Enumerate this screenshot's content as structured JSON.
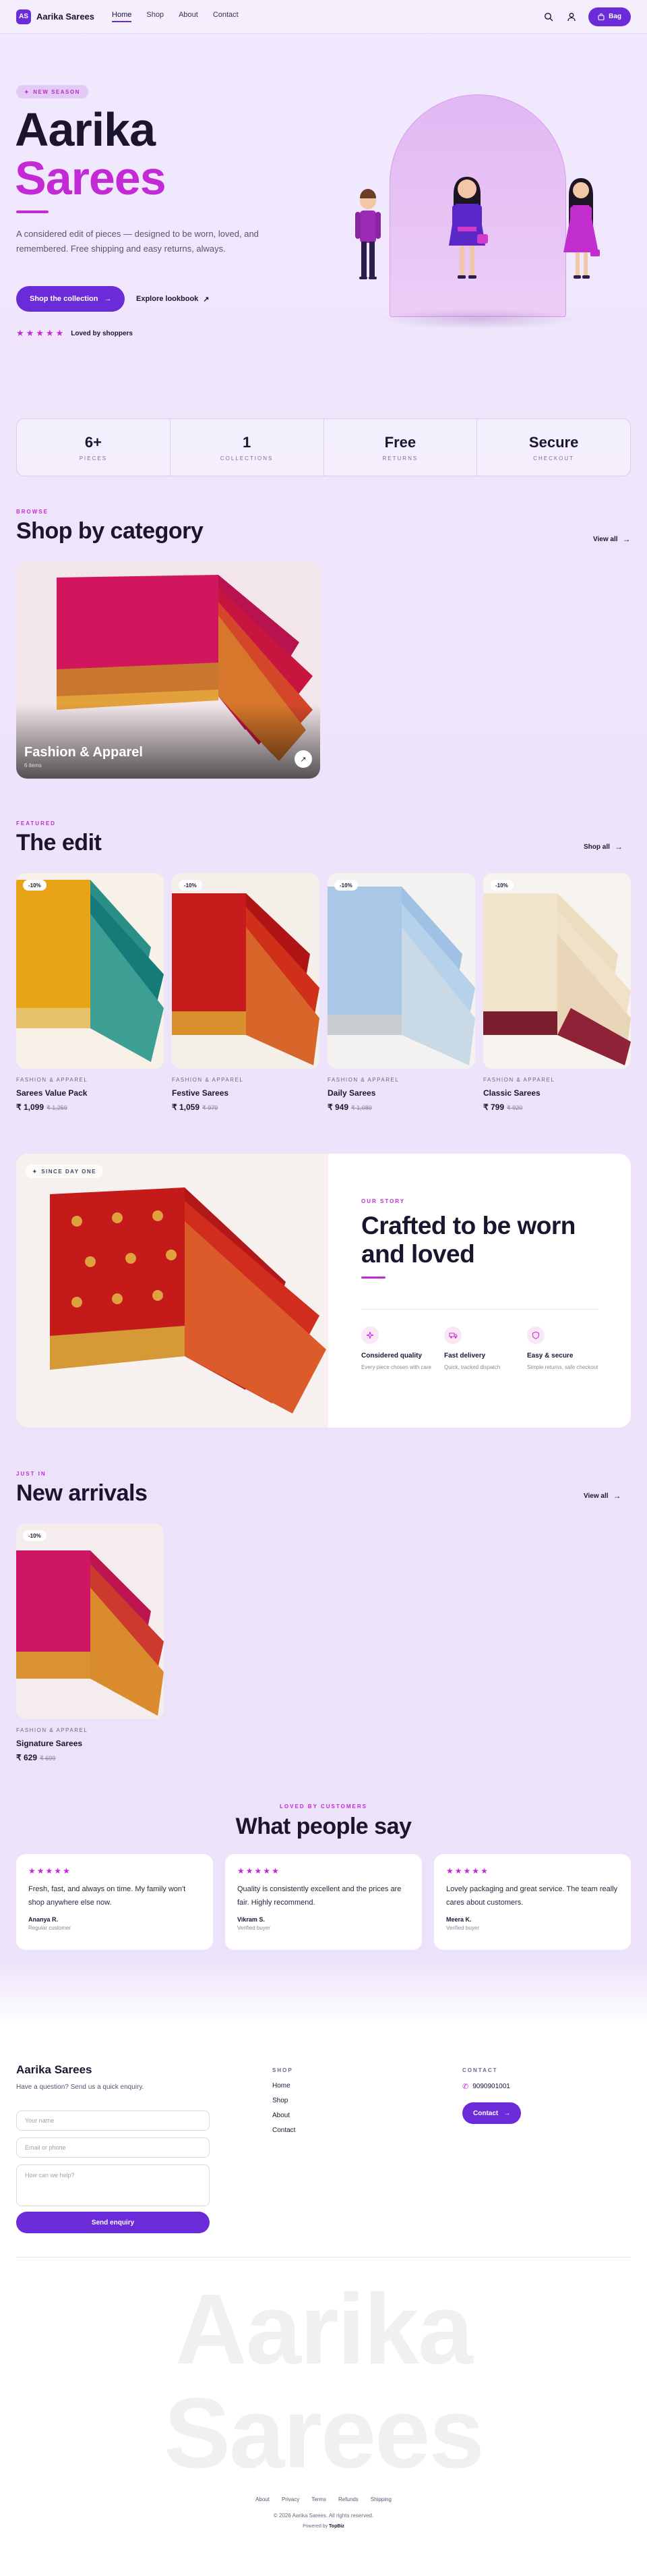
{
  "header": {
    "logo_mark": "AS",
    "brand": "Aarika Sarees",
    "nav": [
      "Home",
      "Shop",
      "About",
      "Contact"
    ],
    "bag_label": "Bag",
    "icons": [
      "search-icon",
      "user-icon",
      "bag-icon"
    ]
  },
  "hero": {
    "pill": "NEW SEASON",
    "title_line1": "Aarika",
    "title_line2": "Sarees",
    "subtitle": "A considered edit of pieces — designed to be worn, loved, and remembered. Free shipping and easy returns, always.",
    "cta_primary": "Shop the collection",
    "cta_secondary": "Explore lookbook",
    "rating_label": "Loved by shoppers",
    "rating_stars": 5
  },
  "stats": [
    {
      "value": "6+",
      "label": "PIECES"
    },
    {
      "value": "1",
      "label": "COLLECTIONS"
    },
    {
      "value": "Free",
      "label": "RETURNS"
    },
    {
      "value": "Secure",
      "label": "CHECKOUT"
    }
  ],
  "categories_section": {
    "eyebrow": "BROWSE",
    "title": "Shop by category",
    "view_all": "View all",
    "items": [
      {
        "title": "Fashion & Apparel",
        "subtitle": "6 items"
      }
    ]
  },
  "edit_section": {
    "eyebrow": "FEATURED",
    "title": "The edit",
    "view_all": "Shop all",
    "products": [
      {
        "badge": "-10%",
        "category": "FASHION & APPAREL",
        "name": "Sarees Value Pack",
        "price": "₹ 1,099",
        "old_price": "₹ 1,259"
      },
      {
        "badge": "-10%",
        "category": "FASHION & APPAREL",
        "name": "Festive Sarees",
        "price": "₹ 1,059",
        "old_price": "₹ 979"
      },
      {
        "badge": "-10%",
        "category": "FASHION & APPAREL",
        "name": "Daily Sarees",
        "price": "₹ 949",
        "old_price": "₹ 1,089"
      },
      {
        "badge": "-10%",
        "category": "FASHION & APPAREL",
        "name": "Classic Sarees",
        "price": "₹ 799",
        "old_price": "₹ 920"
      }
    ]
  },
  "story": {
    "pill": "SINCE DAY ONE",
    "eyebrow": "OUR STORY",
    "title": "Crafted to be worn and loved",
    "features": [
      {
        "icon": "sparkle-icon",
        "title": "Considered quality",
        "desc": "Every piece chosen with care"
      },
      {
        "icon": "truck-icon",
        "title": "Fast delivery",
        "desc": "Quick, tracked dispatch"
      },
      {
        "icon": "shield-icon",
        "title": "Easy & secure",
        "desc": "Simple returns, safe checkout"
      }
    ]
  },
  "arrivals_section": {
    "eyebrow": "JUST IN",
    "title": "New arrivals",
    "view_all": "View all",
    "products": [
      {
        "badge": "-10%",
        "category": "FASHION & APPAREL",
        "name": "Signature Sarees",
        "price": "₹ 629",
        "old_price": "₹ 699"
      }
    ]
  },
  "testimonials": {
    "eyebrow": "LOVED BY CUSTOMERS",
    "title": "What people say",
    "items": [
      {
        "quote": "Fresh, fast, and always on time. My family won't shop anywhere else now.",
        "name": "Ananya R.",
        "role": "Regular customer"
      },
      {
        "quote": "Quality is consistently excellent and the prices are fair. Highly recommend.",
        "name": "Vikram S.",
        "role": "Verified buyer"
      },
      {
        "quote": "Lovely packaging and great service. The team really cares about customers.",
        "name": "Meera K.",
        "role": "Verified buyer"
      }
    ]
  },
  "footer": {
    "brand": "Aarika Sarees",
    "tagline": "Have a question? Send us a quick enquiry.",
    "form": {
      "name_placeholder": "Your name",
      "contact_placeholder": "Email or phone",
      "message_placeholder": "How can we help?",
      "submit": "Send enquiry"
    },
    "shop_heading": "SHOP",
    "shop_links": [
      "Home",
      "Shop",
      "About",
      "Contact"
    ],
    "contact_heading": "CONTACT",
    "phone": "9090901001",
    "contact_button": "Contact",
    "big_word_1": "Aarika",
    "big_word_2": "Sarees",
    "bottom_links": [
      "About",
      "Privacy",
      "Terms",
      "Refunds",
      "Shipping"
    ],
    "copyright": "© 2026 Aarika Sarees. All rights reserved.",
    "powered_prefix": "Powered by",
    "powered_brand": "TopBiz"
  },
  "colors": {
    "accent": "#6c2bd9",
    "magenta": "#c32ad6",
    "ink": "#1c1530",
    "bg_lavender": "#efe6fc"
  }
}
